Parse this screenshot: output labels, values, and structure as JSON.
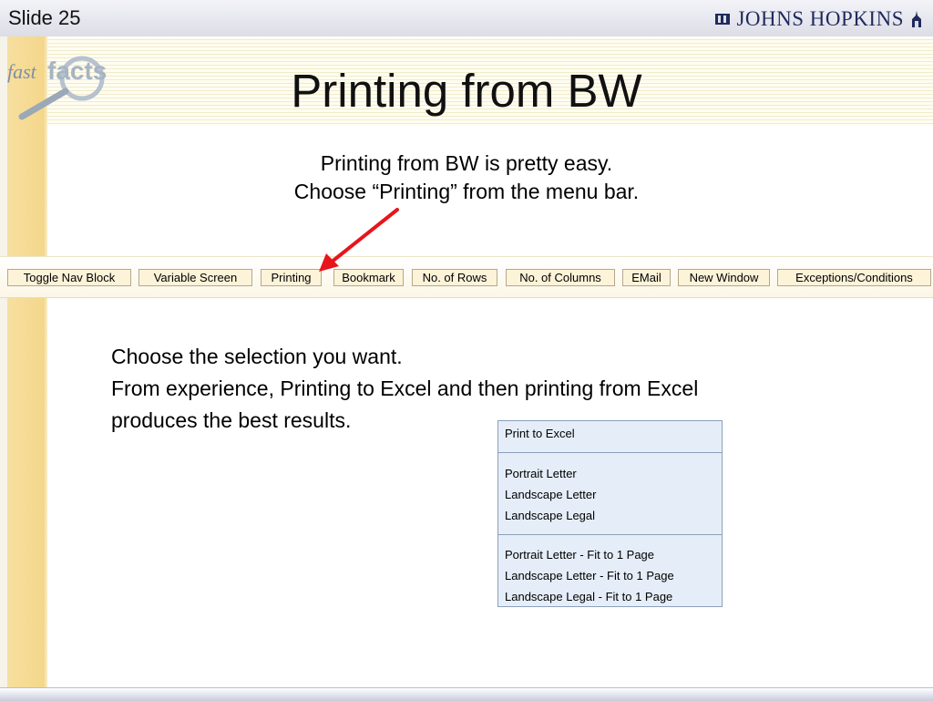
{
  "header": {
    "slide_label": "Slide 25",
    "brand": "JOHNS HOPKINS"
  },
  "logo": {
    "fast": "fast",
    "facts": "facts"
  },
  "title": "Printing from BW",
  "intro": {
    "line1": "Printing from BW is pretty easy.",
    "line2": "Choose “Printing” from the menu bar."
  },
  "toolbar": {
    "buttons": [
      "Toggle Nav Block",
      "Variable Screen",
      "Printing",
      "Bookmark",
      "No. of Rows",
      "No. of Columns",
      "EMail",
      "New Window",
      "Exceptions/Conditions"
    ]
  },
  "body": {
    "line1": "Choose the selection you want.",
    "line2": "From experience, Printing to Excel and then printing from Excel",
    "line3": "produces the best results."
  },
  "print_menu": {
    "items": [
      "Print to Excel",
      "Portrait Letter",
      "Landscape Letter",
      "Landscape Legal",
      "Portrait Letter - Fit to 1 Page",
      "Landscape Letter - Fit to 1 Page",
      "Landscape Legal - Fit to 1 Page"
    ]
  },
  "colors": {
    "arrow": "#e8141b",
    "brand_navy": "#1f2a5c",
    "menu_bg": "#e5eef8",
    "button_bg": "#fdf3d9"
  },
  "icons": {
    "brand_left": "hopkins-shield-icon",
    "brand_right": "dome-icon",
    "pointer": "red-arrow-icon",
    "logo": "magnifier-icon"
  }
}
